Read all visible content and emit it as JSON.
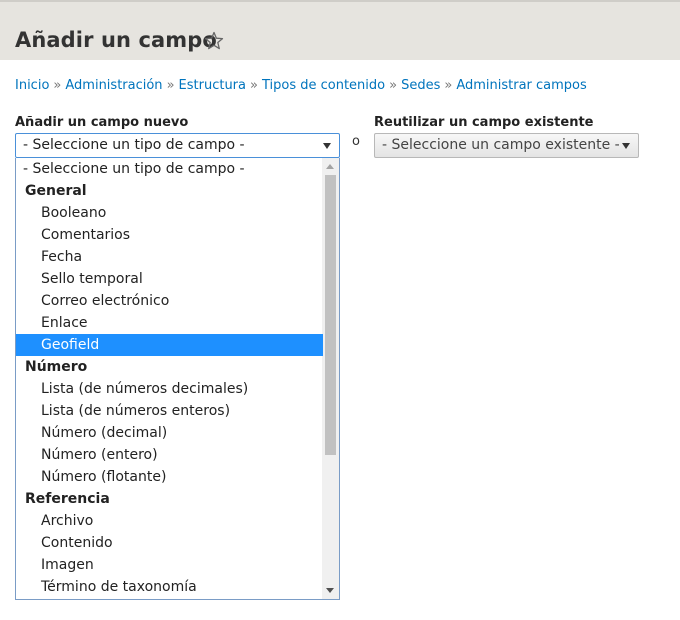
{
  "page": {
    "title": "Añadir un campo"
  },
  "breadcrumb": [
    "Inicio",
    "Administración",
    "Estructura",
    "Tipos de contenido",
    "Sedes",
    "Administrar campos"
  ],
  "breadcrumb_separator": "»",
  "new_field": {
    "label": "Añadir un campo nuevo",
    "selected_value": "- Seleccione un tipo de campo -"
  },
  "or_text": "o",
  "existing_field": {
    "label": "Reutilizar un campo existente",
    "selected_value": "- Seleccione un campo existente -"
  },
  "dropdown": {
    "options": [
      {
        "kind": "head",
        "text": "- Seleccione un tipo de campo -"
      },
      {
        "kind": "group",
        "text": "General"
      },
      {
        "kind": "item",
        "text": "Booleano"
      },
      {
        "kind": "item",
        "text": "Comentarios"
      },
      {
        "kind": "item",
        "text": "Fecha"
      },
      {
        "kind": "item",
        "text": "Sello temporal"
      },
      {
        "kind": "item",
        "text": "Correo electrónico"
      },
      {
        "kind": "item",
        "text": "Enlace"
      },
      {
        "kind": "item",
        "text": "Geofield",
        "selected": true
      },
      {
        "kind": "group",
        "text": "Número"
      },
      {
        "kind": "item",
        "text": "Lista (de números decimales)"
      },
      {
        "kind": "item",
        "text": "Lista (de números enteros)"
      },
      {
        "kind": "item",
        "text": "Número (decimal)"
      },
      {
        "kind": "item",
        "text": "Número (entero)"
      },
      {
        "kind": "item",
        "text": "Número (flotante)"
      },
      {
        "kind": "group",
        "text": "Referencia"
      },
      {
        "kind": "item",
        "text": "Archivo"
      },
      {
        "kind": "item",
        "text": "Contenido"
      },
      {
        "kind": "item",
        "text": "Imagen"
      },
      {
        "kind": "item",
        "text": "Término de taxonomía"
      }
    ]
  },
  "colors": {
    "header_bg": "#e6e4df",
    "link": "#0074bd",
    "selected_option_bg": "#1e90ff"
  }
}
